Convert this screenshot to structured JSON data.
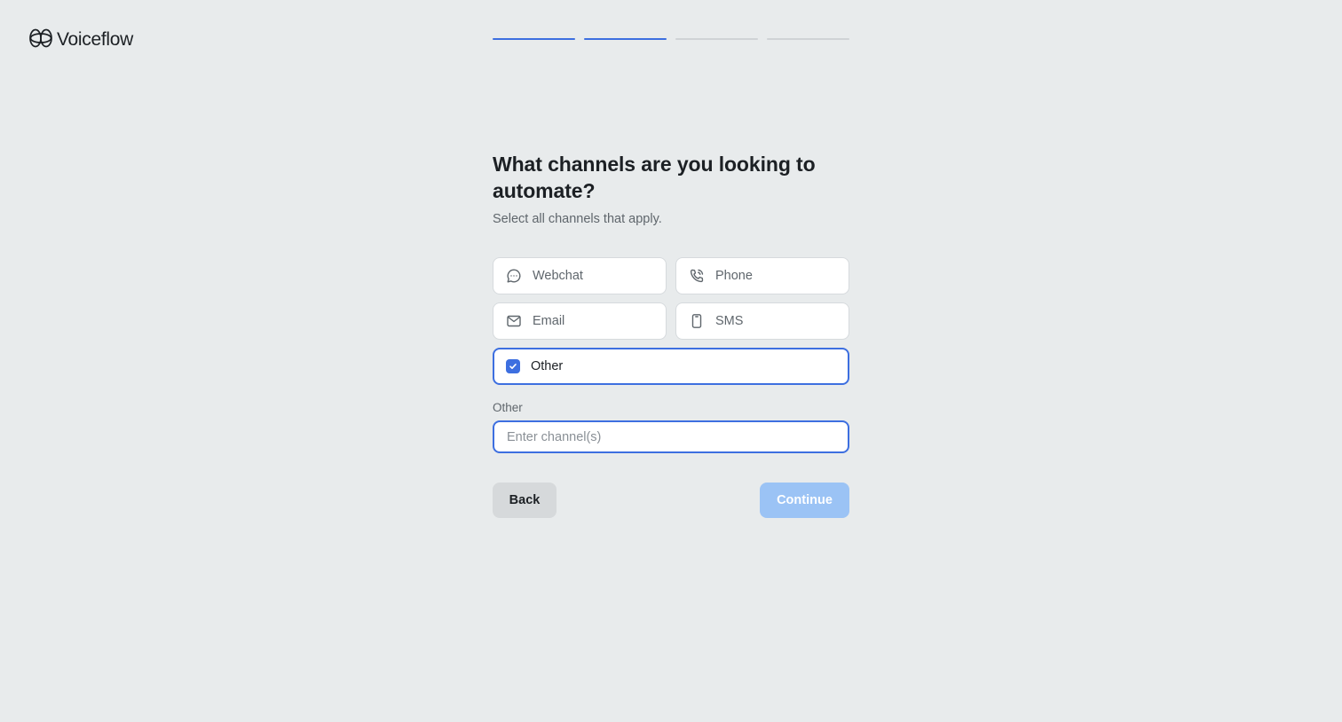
{
  "brand": {
    "name": "Voiceflow",
    "accent": "#3d6fe0"
  },
  "progress": {
    "total_steps": 4,
    "completed_steps": 2
  },
  "question": {
    "title": "What channels are you looking to automate?",
    "subtitle": "Select all channels that apply."
  },
  "options": [
    {
      "label": "Webchat",
      "icon": "chat-bubble-icon",
      "selected": false
    },
    {
      "label": "Phone",
      "icon": "phone-icon",
      "selected": false
    },
    {
      "label": "Email",
      "icon": "mail-icon",
      "selected": false
    },
    {
      "label": "SMS",
      "icon": "mobile-icon",
      "selected": false
    },
    {
      "label": "Other",
      "icon": "checkbox-checked-icon",
      "selected": true
    }
  ],
  "other_field": {
    "label": "Other",
    "placeholder": "Enter channel(s)",
    "value": ""
  },
  "actions": {
    "back_label": "Back",
    "continue_label": "Continue",
    "continue_disabled": true
  }
}
